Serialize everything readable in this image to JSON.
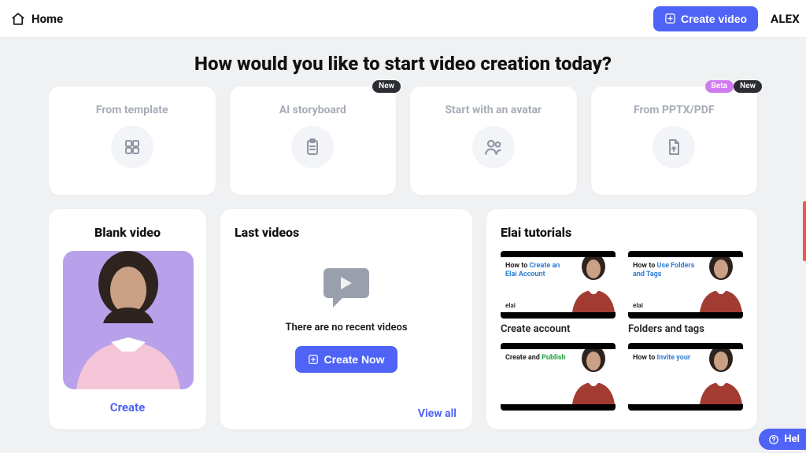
{
  "header": {
    "home_label": "Home",
    "create_video_label": "Create video",
    "username": "ALEX"
  },
  "hero_title": "How would you like to start video creation today?",
  "options": [
    {
      "title": "From template",
      "icon": "grid-icon",
      "badges": []
    },
    {
      "title": "AI storyboard",
      "icon": "clipboard-icon",
      "badges": [
        "New"
      ]
    },
    {
      "title": "Start with an avatar",
      "icon": "people-icon",
      "badges": []
    },
    {
      "title": "From PPTX/PDF",
      "icon": "file-upload-icon",
      "badges": [
        "Beta",
        "New"
      ]
    }
  ],
  "blank": {
    "title": "Blank video",
    "cta": "Create"
  },
  "last": {
    "title": "Last videos",
    "empty_text": "There are no recent videos",
    "cta": "Create Now",
    "view_all": "View all"
  },
  "tutorials": {
    "title": "Elai tutorials",
    "items": [
      {
        "pre": "How to ",
        "accent": "Create an Elai Account",
        "accent_class": "accent1",
        "label": "Create account",
        "brand": "elai"
      },
      {
        "pre": "How to ",
        "accent": "Use Folders and Tags",
        "accent_class": "accent1",
        "label": "Folders and tags",
        "brand": "elai"
      },
      {
        "pre": "Create and ",
        "accent": "Publish",
        "accent_class": "accent2",
        "label": "",
        "brand": ""
      },
      {
        "pre": "How to ",
        "accent": "Invite your",
        "accent_class": "accent1",
        "label": "",
        "brand": ""
      }
    ]
  },
  "help_label": "Hel"
}
